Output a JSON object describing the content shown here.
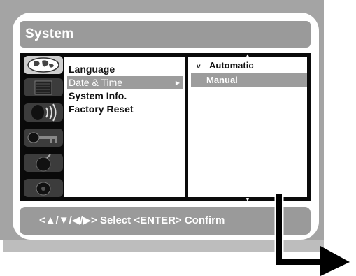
{
  "window": {
    "title": "System"
  },
  "icon_tabs": [
    {
      "name": "globe-icon",
      "selected": true
    },
    {
      "name": "tv-screen-icon",
      "selected": false
    },
    {
      "name": "speaker-icon",
      "selected": false
    },
    {
      "name": "key-icon",
      "selected": false
    },
    {
      "name": "bomb-icon",
      "selected": false
    },
    {
      "name": "disc-icon",
      "selected": false
    }
  ],
  "main_menu": {
    "items": [
      {
        "label": "Language"
      },
      {
        "label": "Date & Time",
        "highlighted": true
      },
      {
        "label": "System Info."
      },
      {
        "label": "Factory Reset"
      }
    ]
  },
  "sub_menu": {
    "items": [
      {
        "label": "Automatic",
        "checked": true,
        "check_mark": "v"
      },
      {
        "label": "Manual",
        "highlighted": true
      }
    ]
  },
  "hint": {
    "text": "<▲/▼/◀/▶> Select  <ENTER> Confirm"
  },
  "colors": {
    "bezel": "#a4a4a4",
    "bar": "#9a9a9a",
    "menu_background": "#0a0a0a",
    "highlight": "#9c9c9c"
  }
}
